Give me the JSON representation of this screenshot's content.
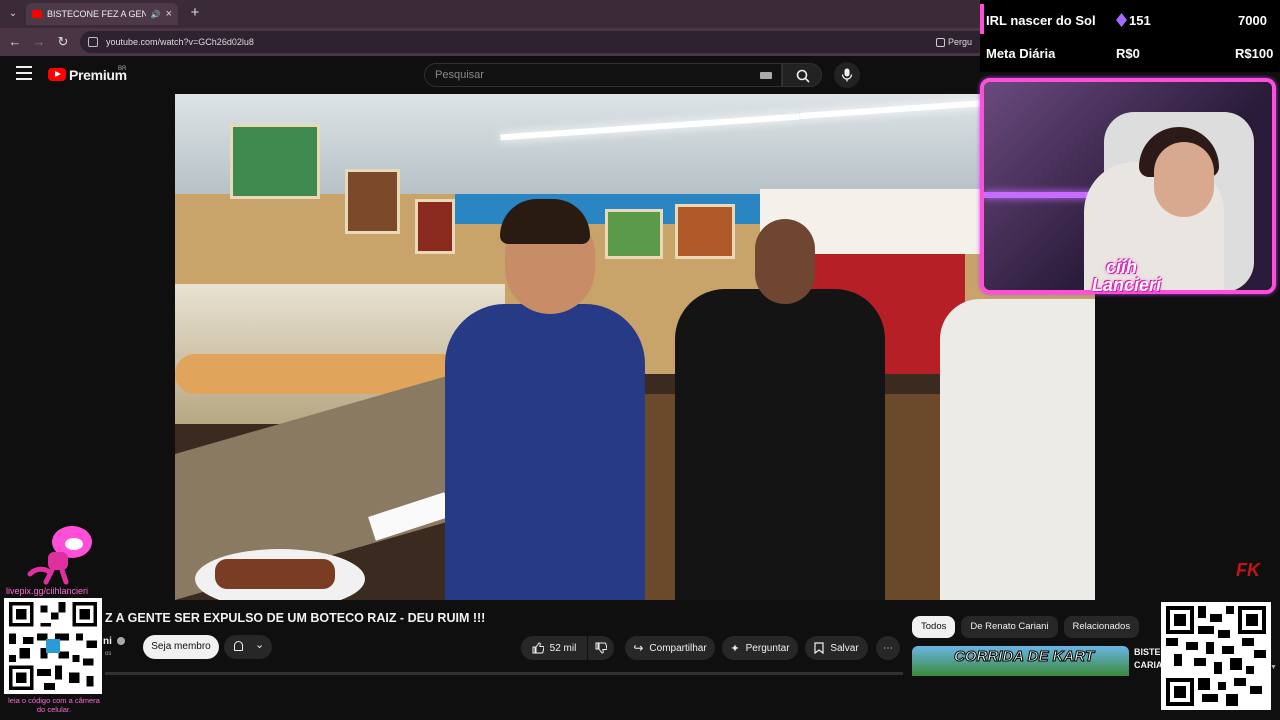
{
  "browser": {
    "tab_title": "BISTECONE FEZ A GENTE S",
    "url": "youtube.com/watch?v=GCh26d02lu8",
    "extension_label": "Pergu"
  },
  "youtube": {
    "brand": "Premium",
    "region": "BR",
    "search_placeholder": "Pesquisar"
  },
  "stream_overlay": {
    "goal_title": "IRL nascer do Sol",
    "goal_current": "151",
    "goal_target": "7000",
    "daily_label": "Meta Diária",
    "daily_current": "R$0",
    "daily_target": "R$100",
    "streamer_name_line1": "ciih",
    "streamer_name_line2": "Lancieri",
    "accent_color": "#ff4fd8",
    "livepix_url": "livepix.gg/ciihlancieri",
    "qr_hint": "leia o código com a câmera do celular."
  },
  "video": {
    "title": "Z A GENTE SER EXPULSO DE UM BOTECO RAIZ - DEU RUIM !!!",
    "channel": "ni",
    "subs": "os",
    "member_btn": "Seja membro",
    "likes": "52 mil",
    "share": "Compartilhar",
    "ask": "Perguntar",
    "save": "Salvar",
    "watermark": "FK"
  },
  "related": {
    "chips": [
      "Todos",
      "De Renato Cariani",
      "Relacionados"
    ],
    "thumb_text": "CORRIDA DE KART",
    "item_title_line1": "BISTEC",
    "item_title_line2": "CARIA"
  }
}
